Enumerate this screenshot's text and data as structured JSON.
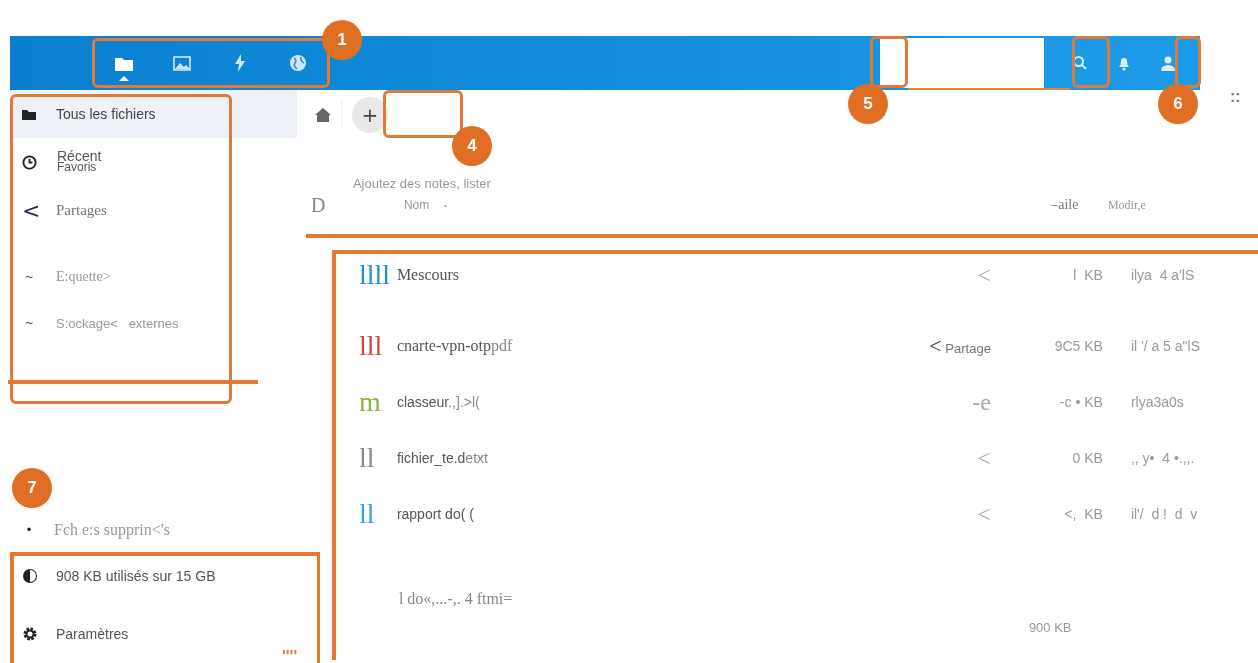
{
  "header": {
    "apps": [
      {
        "kind": "folder",
        "selected": true
      },
      {
        "kind": "image",
        "selected": false
      },
      {
        "kind": "bolt",
        "selected": false
      },
      {
        "kind": "globe",
        "selected": false
      }
    ]
  },
  "sidebar": {
    "items": [
      {
        "kind": "folder",
        "label": "Tous les fichiers",
        "selected": true
      },
      {
        "kind": "clock",
        "label": "Récent",
        "label_2": "Favoris",
        "selected": false
      },
      {
        "kind": "glyph",
        "glyph": "<",
        "label": "Partages",
        "selected": false
      },
      {
        "kind": "glyph",
        "glyph": "~",
        "label": "E:quette>",
        "selected": false
      },
      {
        "kind": "glyph",
        "glyph": "~",
        "label": "S:ockage<   externes",
        "selected": false
      }
    ],
    "footer": [
      {
        "kind": "glyph",
        "glyph": "•",
        "label": "Fch e:s supprin<'s"
      },
      {
        "kind": "pie",
        "label": "908 KB utilisés sur 15 GB"
      },
      {
        "kind": "gear",
        "label": "Paramètres"
      }
    ]
  },
  "breadcrumb": {
    "new_button": "+"
  },
  "notes_hint": "Ajoutez des notes, lister",
  "table": {
    "columns": [
      "D",
      "Nom",
      "•",
      "–aile",
      "Modir,e"
    ],
    "rows": [
      {
        "icon_text": "llll",
        "color": "#1f8fd6",
        "name": "Mescours",
        "ext": "",
        "share": "<",
        "share_label": "",
        "size": "l  KB",
        "modified": "ilya  4 a'lS"
      },
      {
        "icon_text": "lll",
        "color": "#d9453b",
        "name": "cnarte-vpn-otp",
        "ext": "pdf",
        "share": "<",
        "share_label": "Partage",
        "size": "9C5 KB",
        "modified": "il '/ a 5 a\"lS"
      },
      {
        "icon_text": "m",
        "color": "#8ab83f",
        "name": "classeur",
        "ext": ".,].>l(",
        "share": "-e",
        "share_label": "",
        "size": "-c • KB",
        "modified": "rlya3a0s"
      },
      {
        "icon_text": "ll",
        "color": "#8c8c8c",
        "name": "fichier_te.d",
        "ext": "etxt",
        "share": "<",
        "share_label": "",
        "size": "0 KB",
        "modified": ",, y•  4 •.,,."
      },
      {
        "icon_text": "ll",
        "color": "#3aa3e8",
        "name": "rapport do( (",
        "ext": "",
        "share": "<",
        "share_label": "",
        "size": "<,  KB",
        "modified": "il'/  d !  d  v"
      }
    ],
    "summary": "l do«,...-,. 4 ftmi=",
    "summary_size": "900 KB"
  },
  "callouts": [
    "1",
    "4",
    "5",
    "6",
    "7"
  ],
  "edge_marks": "::",
  "stray_marks": "''''"
}
